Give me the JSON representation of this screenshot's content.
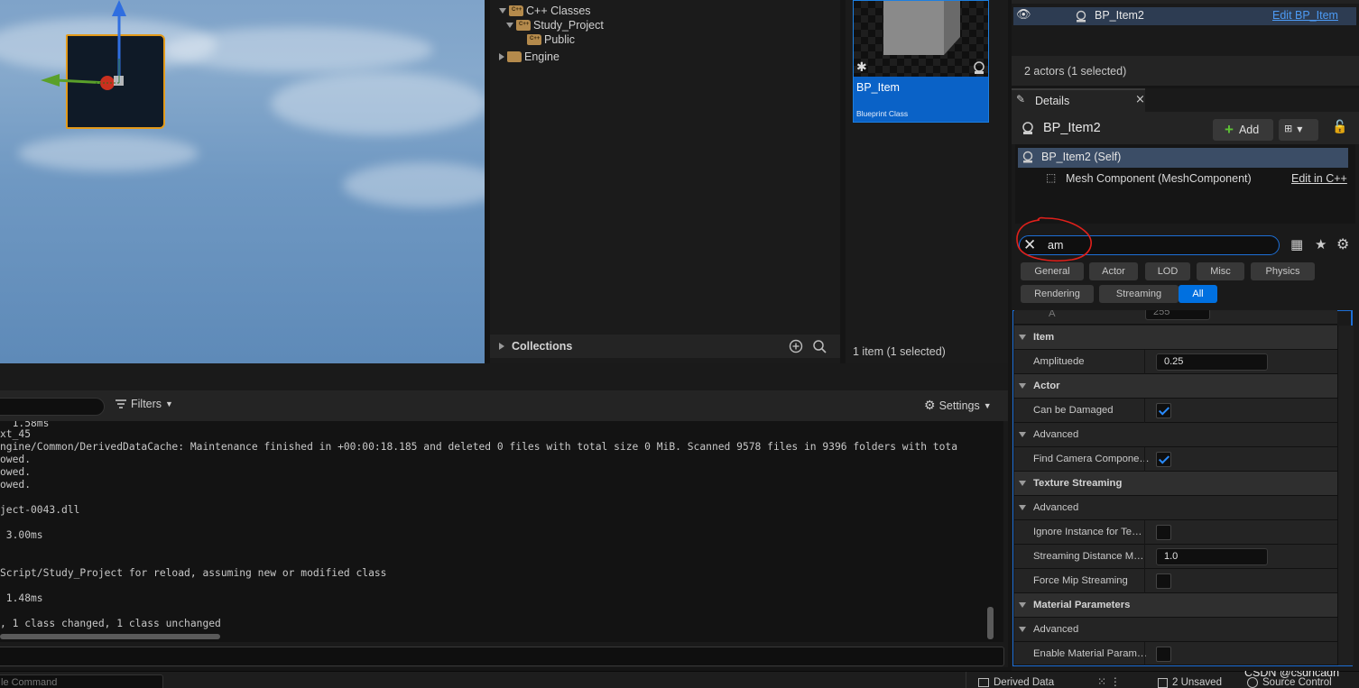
{
  "content_browser": {
    "tree": [
      "C++ Classes",
      "Study_Project",
      "Public",
      "Engine"
    ],
    "collections_label": "Collections",
    "asset": {
      "name": "BP_Item",
      "type": "Blueprint Class"
    },
    "item_count": "1 item (1 selected)"
  },
  "outliner": {
    "selected_actor": "BP_Item2",
    "selected_link": "Edit BP_Item",
    "actor_count": "2 actors (1 selected)"
  },
  "details": {
    "tab_label": "Details",
    "object_name": "BP_Item2",
    "add_label": "Add",
    "components": {
      "self": "BP_Item2 (Self)",
      "mesh": "Mesh Component (MeshComponent)",
      "edit_cpp": "Edit in C++"
    },
    "search_value": "am",
    "filter_tabs": [
      "General",
      "Actor",
      "LOD",
      "Misc",
      "Physics",
      "Rendering",
      "Streaming",
      "All"
    ],
    "active_filter": "All",
    "partial_row": {
      "label": "A",
      "value": "255"
    },
    "sections": {
      "item": "Item",
      "amplitude_label": "Amplituede",
      "amplitude_value": "0.25",
      "actor": "Actor",
      "can_be_damaged": "Can be Damaged",
      "advanced1": "Advanced",
      "find_camera": "Find Camera Compone…",
      "texture_streaming": "Texture Streaming",
      "advanced2": "Advanced",
      "ignore_instance": "Ignore Instance for Te…",
      "streaming_distance": "Streaming Distance M…",
      "streaming_distance_value": "1.0",
      "force_mip": "Force Mip Streaming",
      "material_params": "Material Parameters",
      "advanced3": "Advanced",
      "enable_material": "Enable Material Param…"
    },
    "checkbox_states": {
      "can_be_damaged": true,
      "find_camera": true,
      "ignore_instance": false,
      "force_mip": false,
      "enable_material": false
    }
  },
  "output_log": {
    "filters_label": "Filters",
    "settings_label": "Settings",
    "lines": [
      "  1.58ms",
      "xt_45",
      "ngine/Common/DerivedDataCache: Maintenance finished in +00:00:18.185 and deleted 0 files with total size 0 MiB. Scanned 9578 files in 9396 folders with tota",
      "owed.",
      "owed.",
      "owed.",
      "ject-0043.dll",
      "",
      " 3.00ms",
      "",
      "",
      "Script/Study_Project for reload, assuming new or modified class",
      "",
      " 1.48ms",
      "",
      ", 1 class changed, 1 class unchanged"
    ],
    "command_placeholder": "le Command"
  },
  "status_bar": {
    "derived_data": "Derived Data",
    "unsaved": "2 Unsaved",
    "source_control": "Source Control",
    "watermark": "CSDN @csdncadn"
  },
  "colors": {
    "accent": "#0070e0",
    "selection": "#0a62c7",
    "annotation": "#e0201b",
    "actor_outline": "#e39a1a"
  }
}
